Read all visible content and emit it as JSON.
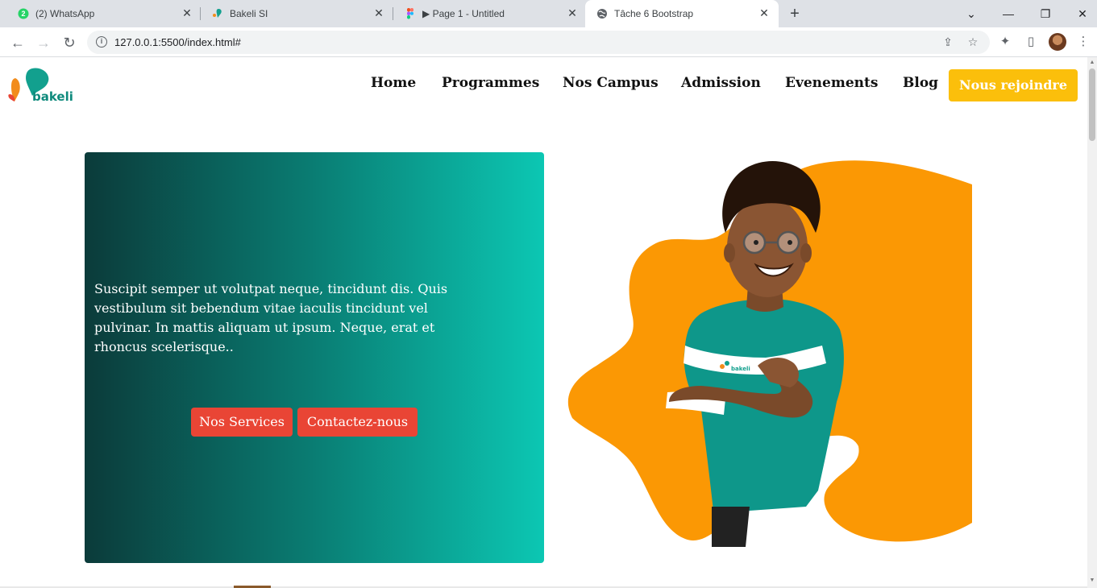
{
  "browser": {
    "tabs": [
      {
        "title": "(2) WhatsApp",
        "icon": "whatsapp-icon"
      },
      {
        "title": "Bakeli SI",
        "icon": "bakeli-icon"
      },
      {
        "title": "▶ Page 1 - Untitled",
        "icon": "figma-icon"
      },
      {
        "title": "Tâche 6 Bootstrap",
        "icon": "globe-icon",
        "active": true
      }
    ],
    "whatsapp_badge": "2",
    "url": "127.0.0.1:5500/index.html#"
  },
  "navbar": {
    "logo_text": "bakeli",
    "items": [
      "Home",
      "Programmes",
      "Nos Campus",
      "Admission",
      "Evenements",
      "Blog"
    ],
    "cta": "Nous rejoindre"
  },
  "hero": {
    "text": "Suscipit semper ut volutpat neque, tincidunt dis. Quis vestibulum sit bebendum vitae iaculis tincidunt vel pulvinar. In mattis aliquam ut ipsum. Neque, erat et rhoncus scelerisque..",
    "btn_services": "Nos Services",
    "btn_contact": "Contactez-nous"
  },
  "illustration": {
    "shirt_logo_text": "bakeli"
  },
  "colors": {
    "accent_yellow": "#fbbf0b",
    "button_red": "#e94535",
    "teal_dark": "#0b3b3a",
    "teal_light": "#0cc7b3",
    "blob_orange": "#fb9804"
  }
}
